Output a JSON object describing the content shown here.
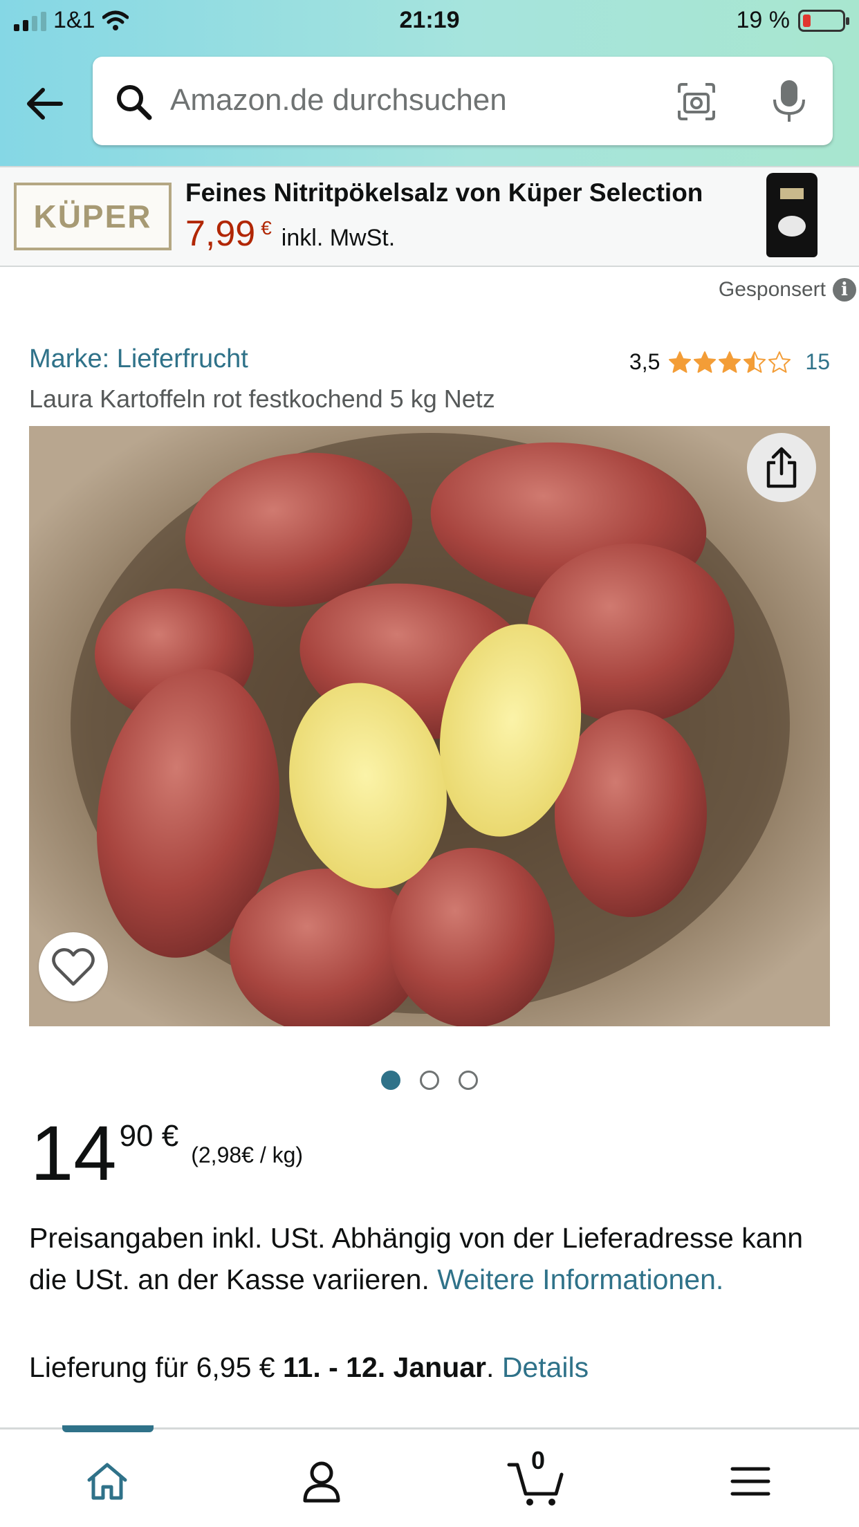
{
  "status": {
    "carrier": "1&1",
    "time": "21:19",
    "battery": "19 %"
  },
  "search": {
    "placeholder": "Amazon.de durchsuchen"
  },
  "ad": {
    "logo": "KÜPER",
    "title": "Feines Nitritpökelsalz von Küper Selection",
    "price": "7,99",
    "currency": "€",
    "tax": "inkl. MwSt.",
    "sponsored": "Gesponsert"
  },
  "product": {
    "brand": "Marke: Lieferfrucht",
    "rating": "3,5",
    "rating_value": 3.5,
    "rating_max": 5,
    "review_count": "15",
    "title": "Laura Kartoffeln rot festkochend 5 kg Netz",
    "image_count": 3,
    "image_index": 1,
    "price_whole": "14",
    "price_fraction": "90 €",
    "unit_price": "(2,98€ / kg)",
    "tax_note": "Preisangaben inkl. USt. Abhängig von der Lieferadresse kann die USt. an der Kasse variieren.",
    "tax_link": "Weitere Informationen.",
    "delivery_prefix": "Lieferung für 6,95 €",
    "delivery_dates": "11. - 12. Januar",
    "delivery_suffix": ".",
    "delivery_link": "Details"
  },
  "nav": {
    "cart_count": "0"
  },
  "colors": {
    "link": "#2f7289",
    "price": "#b12704",
    "star": "#f39d37"
  },
  "icons": [
    "back-arrow-icon",
    "search-icon",
    "camera-icon",
    "microphone-icon",
    "info-icon",
    "star-icon",
    "share-icon",
    "heart-icon",
    "home-icon",
    "account-icon",
    "cart-icon",
    "menu-icon"
  ]
}
